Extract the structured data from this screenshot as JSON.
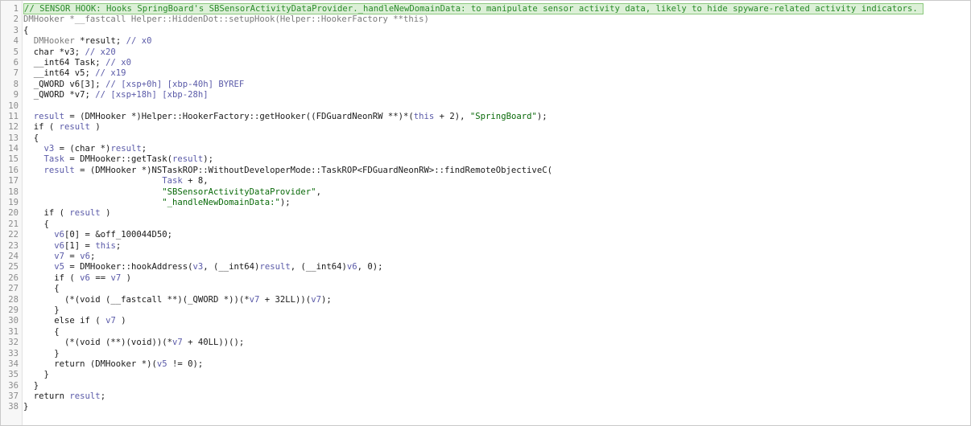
{
  "code_view": {
    "lines": [
      {
        "n": "1",
        "text": "// SENSOR HOOK: Hooks SpringBoard's SBSensorActivityDataProvider._handleNewDomainData: to manipulate sensor activity data, likely to hide spyware-related activity indicators.",
        "kind": "comment"
      },
      {
        "n": "2",
        "text": "DMHooker *__fastcall Helper::HiddenDot::setupHook(Helper::HookerFactory **this)",
        "kind": "signature"
      },
      {
        "n": "3",
        "text": "{",
        "kind": "code"
      },
      {
        "n": "4",
        "text": "  DMHooker *result; // x0",
        "kind": "decl"
      },
      {
        "n": "5",
        "text": "  char *v3; // x20",
        "kind": "decl"
      },
      {
        "n": "6",
        "text": "  __int64 Task; // x0",
        "kind": "decl"
      },
      {
        "n": "7",
        "text": "  __int64 v5; // x19",
        "kind": "decl"
      },
      {
        "n": "8",
        "text": "  _QWORD v6[3]; // [xsp+0h] [xbp-40h] BYREF",
        "kind": "decl"
      },
      {
        "n": "9",
        "text": "  _QWORD *v7; // [xsp+18h] [xbp-28h]",
        "kind": "decl"
      },
      {
        "n": "10",
        "text": "",
        "kind": "code"
      },
      {
        "n": "11",
        "text": "  result = (DMHooker *)Helper::HookerFactory::getHooker((FDGuardNeonRW **)*(this + 2), \"SpringBoard\");",
        "kind": "code"
      },
      {
        "n": "12",
        "text": "  if ( result )",
        "kind": "code"
      },
      {
        "n": "13",
        "text": "  {",
        "kind": "code"
      },
      {
        "n": "14",
        "text": "    v3 = (char *)result;",
        "kind": "code"
      },
      {
        "n": "15",
        "text": "    Task = DMHooker::getTask(result);",
        "kind": "code"
      },
      {
        "n": "16",
        "text": "    result = (DMHooker *)NSTaskROP::WithoutDeveloperMode::TaskROP<FDGuardNeonRW>::findRemoteObjectiveC(",
        "kind": "code"
      },
      {
        "n": "17",
        "text": "                           Task + 8,",
        "kind": "code"
      },
      {
        "n": "18",
        "text": "                           \"SBSensorActivityDataProvider\",",
        "kind": "code"
      },
      {
        "n": "19",
        "text": "                           \"_handleNewDomainData:\");",
        "kind": "code"
      },
      {
        "n": "20",
        "text": "    if ( result )",
        "kind": "code"
      },
      {
        "n": "21",
        "text": "    {",
        "kind": "code"
      },
      {
        "n": "22",
        "text": "      v6[0] = &off_100044D50;",
        "kind": "code"
      },
      {
        "n": "23",
        "text": "      v6[1] = this;",
        "kind": "code"
      },
      {
        "n": "24",
        "text": "      v7 = v6;",
        "kind": "code"
      },
      {
        "n": "25",
        "text": "      v5 = DMHooker::hookAddress(v3, (__int64)result, (__int64)v6, 0);",
        "kind": "code"
      },
      {
        "n": "26",
        "text": "      if ( v6 == v7 )",
        "kind": "code"
      },
      {
        "n": "27",
        "text": "      {",
        "kind": "code"
      },
      {
        "n": "28",
        "text": "        (*(void (__fastcall **)(_QWORD *))(*v7 + 32LL))(v7);",
        "kind": "code"
      },
      {
        "n": "29",
        "text": "      }",
        "kind": "code"
      },
      {
        "n": "30",
        "text": "      else if ( v7 )",
        "kind": "code"
      },
      {
        "n": "31",
        "text": "      {",
        "kind": "code"
      },
      {
        "n": "32",
        "text": "        (*(void (**)(void))(*v7 + 40LL))();",
        "kind": "code"
      },
      {
        "n": "33",
        "text": "      }",
        "kind": "code"
      },
      {
        "n": "34",
        "text": "      return (DMHooker *)(v5 != 0);",
        "kind": "code"
      },
      {
        "n": "35",
        "text": "    }",
        "kind": "code"
      },
      {
        "n": "36",
        "text": "  }",
        "kind": "code"
      },
      {
        "n": "37",
        "text": "  return result;",
        "kind": "code"
      },
      {
        "n": "38",
        "text": "}",
        "kind": "code"
      }
    ],
    "colors": {
      "comment": "#2a8a2a",
      "highlight_bg": "#dcf0d7",
      "highlight_border": "#8bc87d",
      "line_number": "#8c8c8c",
      "identifier": "#5a5aa8",
      "type_gray": "#7a7a7a"
    }
  }
}
